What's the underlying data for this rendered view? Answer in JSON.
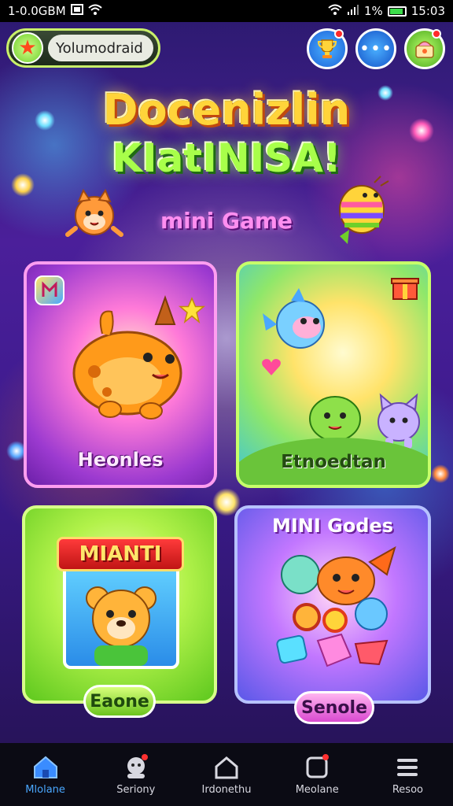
{
  "status_bar": {
    "left_text": "1-0.0GBM",
    "battery_text": "1%",
    "time": "15:03"
  },
  "header": {
    "profile_name": "Yolumodraid",
    "profile_icon": "star-icon",
    "buttons": [
      {
        "name": "trophy-button",
        "icon": "trophy-icon"
      },
      {
        "name": "more-button",
        "icon": "more-dots-icon",
        "label": "•••"
      },
      {
        "name": "shop-button",
        "icon": "shop-icon"
      }
    ]
  },
  "hero": {
    "title_line1": "Docenizlin",
    "title_line2": "KIatINISA!",
    "subtitle": "mini Game"
  },
  "cards": [
    {
      "label": "Heonles",
      "corner_icon": "badge-icon"
    },
    {
      "label": "Etnoedtan",
      "corner_icon": "gift-icon"
    },
    {
      "banner": "MIANTI",
      "button_label": "Eaone"
    },
    {
      "top_label": "MINI Godes",
      "button_label": "Senole"
    }
  ],
  "bottom_nav": [
    {
      "label": "Mlolane",
      "icon": "home-icon",
      "active": true
    },
    {
      "label": "Seriony",
      "icon": "character-icon",
      "active": false
    },
    {
      "label": "Irdonethu",
      "icon": "house-outline-icon",
      "active": false
    },
    {
      "label": "Meolane",
      "icon": "square-badge-icon",
      "active": false
    },
    {
      "label": "Resoo",
      "icon": "menu-icon",
      "active": false
    }
  ],
  "colors": {
    "accent_blue": "#4aa8ff",
    "title_yellow": "#ffd43a",
    "title_green": "#a8ff4a",
    "subtitle_pink": "#ff8ef0"
  }
}
